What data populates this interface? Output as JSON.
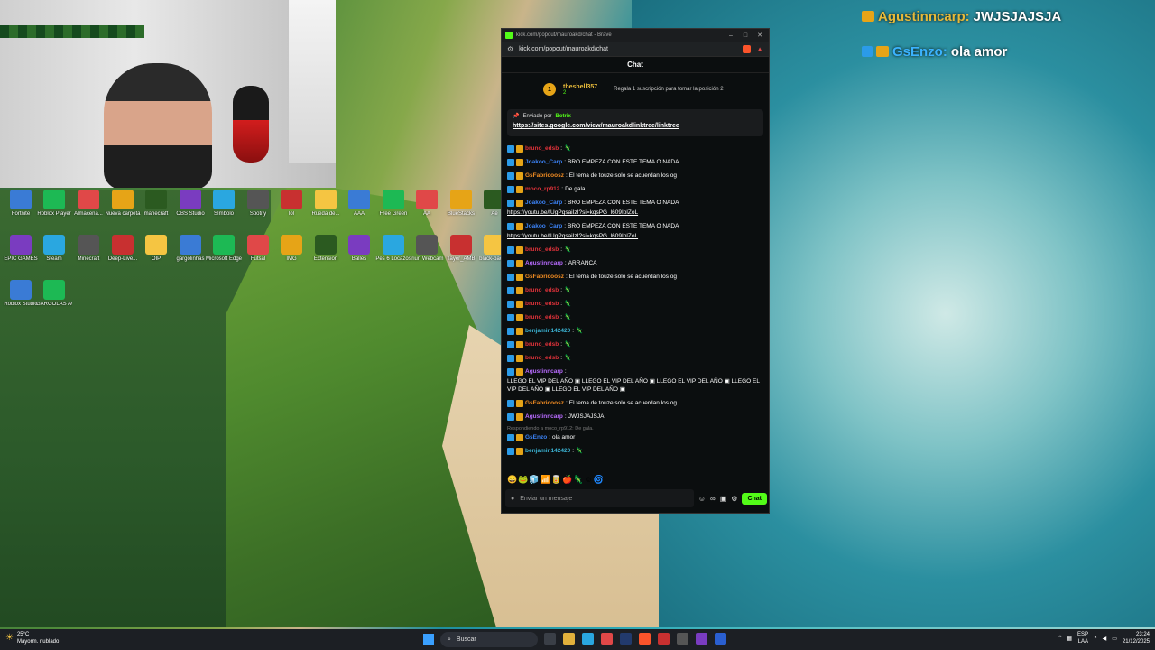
{
  "overlay": {
    "line1_user": "Agustinncarp:",
    "line1_text": "JWJSJAJSJA",
    "line2_user": "GsEnzo:",
    "line2_text": "ola amor"
  },
  "browser": {
    "title": "kick.com/popout/mauroakd/chat - Brave",
    "url": "kick.com/popout/mauroakd/chat",
    "chat_header": "Chat",
    "top_gifter_name": "theshell357",
    "top_gifter_count": "2",
    "position_number": "1",
    "gift_prompt": "Regala 1 suscripción para tomar la posición 2",
    "pinned_by_label": "Enviado por",
    "pinned_by_user": "Botrix",
    "pinned_link": "https://sites.google.com/view/mauroakdlinktree/linktree",
    "messages": [
      {
        "user": "bruno_edsb",
        "ucolor": "u-red",
        "text": "",
        "link": ""
      },
      {
        "user": "Joakoo_Carp",
        "ucolor": "u-blue",
        "text": "BRO EMPEZA CON ESTE TEMA O NADA",
        "link": ""
      },
      {
        "user": "GsFabricoosz",
        "ucolor": "u-orange",
        "text": "El tema de touze solo se acuerdan los og",
        "link": ""
      },
      {
        "user": "moco_rp912",
        "ucolor": "u-red",
        "text": "De gala.",
        "link": ""
      },
      {
        "user": "Joakoo_Carp",
        "ucolor": "u-blue",
        "text": "BRO EMPEZA CON ESTE TEMA O NADA",
        "link": "https://youtu.be/tUgPqsaiIzI?si=kqsPG_l609IplZoL"
      },
      {
        "user": "Joakoo_Carp",
        "ucolor": "u-blue",
        "text": "BRO EMPEZA CON ESTE TEMA O NADA",
        "link": "https://youtu.be/tUgPqsaiIzI?si=kqsPG_l609IplZoL"
      },
      {
        "user": "bruno_edsb",
        "ucolor": "u-red",
        "text": "",
        "link": ""
      },
      {
        "user": "Agustinncarp",
        "ucolor": "u-purple",
        "text": "ARRANCA",
        "link": ""
      },
      {
        "user": "GsFabricoosz",
        "ucolor": "u-orange",
        "text": "El tema de touze solo se acuerdan los og",
        "link": ""
      },
      {
        "user": "bruno_edsb",
        "ucolor": "u-red",
        "text": "",
        "link": ""
      },
      {
        "user": "bruno_edsb",
        "ucolor": "u-red",
        "text": "",
        "link": ""
      },
      {
        "user": "bruno_edsb",
        "ucolor": "u-red",
        "text": "",
        "link": ""
      },
      {
        "user": "benjamin142420",
        "ucolor": "u-teal",
        "text": "",
        "link": ""
      },
      {
        "user": "bruno_edsb",
        "ucolor": "u-red",
        "text": "",
        "link": ""
      },
      {
        "user": "bruno_edsb",
        "ucolor": "u-red",
        "text": "",
        "link": ""
      },
      {
        "user": "Agustinncarp",
        "ucolor": "u-purple",
        "text": "LLEGO EL VIP DEL AÑO ▣ LLEGO EL VIP DEL AÑO ▣ LLEGO EL VIP DEL AÑO ▣ LLEGO EL VIP DEL AÑO ▣ LLEGO EL VIP DEL AÑO ▣",
        "link": ""
      },
      {
        "user": "GsFabricoosz",
        "ucolor": "u-orange",
        "text": "El tema de touze solo se acuerdan los og",
        "link": ""
      },
      {
        "user": "Agustinncarp",
        "ucolor": "u-purple",
        "text": "JWJSJAJSJA",
        "link": ""
      },
      {
        "user": "GsEnzo",
        "ucolor": "u-blue",
        "text": "ola amor",
        "link": "",
        "reply": "Respondiendo a moco_rp912: De gala."
      },
      {
        "user": "benjamin142420",
        "ucolor": "u-teal",
        "text": "",
        "link": ""
      }
    ],
    "input_placeholder": "Enviar un mensaje",
    "send_label": "Chat"
  },
  "taskbar": {
    "temp": "25°C",
    "weather": "Mayorm. nublado",
    "search_placeholder": "Buscar",
    "lang": "ESP",
    "lang2": "LAA",
    "time": "23:24",
    "date": "21/12/2025"
  },
  "desktop_icons": [
    "Fortnite",
    "Roblox Player",
    "Almacena...",
    "Nueva carpeta",
    "manecraft",
    "OBS Studio",
    "SImbolo",
    "Spotify",
    "lol",
    "Rueda de...",
    "AAA",
    "Free Green",
    "AA",
    "BlueStacks",
    "Ae",
    "EPIC GAMES",
    "Steam",
    "Minecraft",
    "Deep-Live...",
    "OIP",
    "gargolinhas",
    "Microsoft Edge",
    "Futsal",
    "IMG",
    "Extension",
    "Balles",
    "Pes 6 Locazos",
    "Iriun Webcam",
    "flayer_AMB",
    "black-back...",
    "Roblox Studio",
    "GARGOLAS AWARD"
  ]
}
